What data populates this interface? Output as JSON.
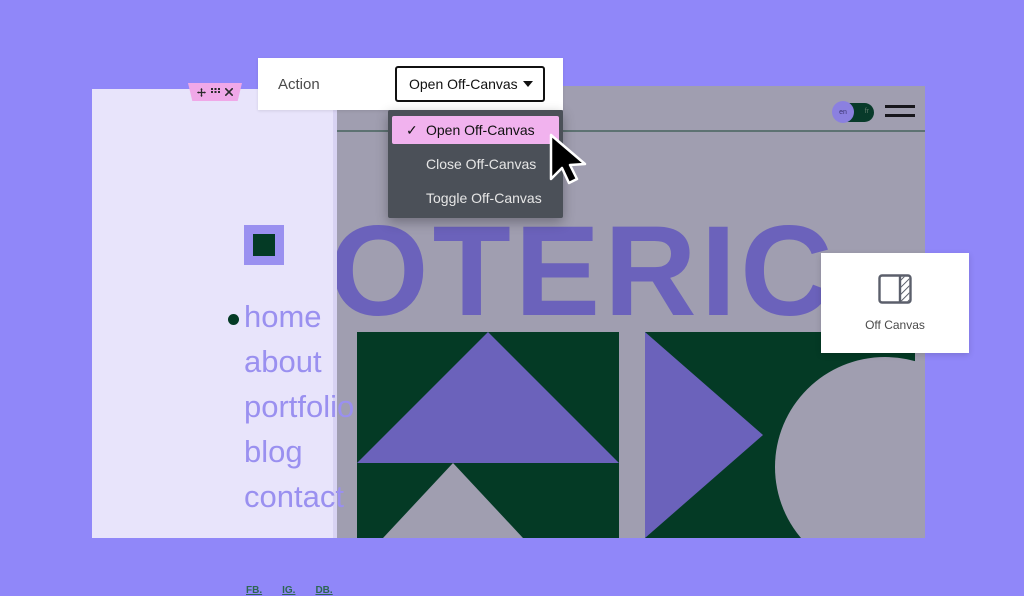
{
  "page": {
    "background_color": "#9087f9"
  },
  "action_bar": {
    "label": "Action",
    "select": {
      "value": "Open Off-Canvas",
      "caret_icon": "chevron-down-icon"
    }
  },
  "dropdown": {
    "options": [
      {
        "label": "Open Off-Canvas",
        "selected": true,
        "check_icon": "check-icon"
      },
      {
        "label": "Close Off-Canvas",
        "selected": false
      },
      {
        "label": "Toggle Off-Canvas",
        "selected": false
      }
    ],
    "panel_color": "#4b5058",
    "highlight_color": "#f1b2ee"
  },
  "offcanvas_panel": {
    "background_color": "#e8e4fb",
    "tab": {
      "color": "#f0a8e8",
      "icons": [
        "move-icon",
        "grid-handle-icon",
        "close-icon"
      ]
    },
    "logo": {
      "outer_color": "#9a90f0",
      "inner_color": "#043a25"
    },
    "nav_items": [
      {
        "label": "home",
        "active": true
      },
      {
        "label": "about",
        "active": false
      },
      {
        "label": "portfolio",
        "active": false
      },
      {
        "label": "blog",
        "active": false
      },
      {
        "label": "contact",
        "active": false
      }
    ],
    "socials": [
      {
        "label": "FB."
      },
      {
        "label": "IG."
      },
      {
        "label": "DB."
      }
    ]
  },
  "site_canvas": {
    "background_color": "#a09eb0",
    "hero_text": "OTERIC",
    "hero_color": "#6b62bb",
    "language_toggle": {
      "active": "en",
      "inactive": "fr",
      "track_color": "#083a2a",
      "knob_color": "#8b80e0"
    },
    "menu_icon": "hamburger-icon",
    "panels": [
      {
        "name": "triangle-panel",
        "background_color": "#043a25"
      },
      {
        "name": "arrow-circle-panel",
        "background_color": "#043a25"
      }
    ]
  },
  "widget_card": {
    "label": "Off Canvas",
    "icon": "off-canvas-icon"
  },
  "cursor": {
    "icon": "pointer-cursor-icon"
  }
}
